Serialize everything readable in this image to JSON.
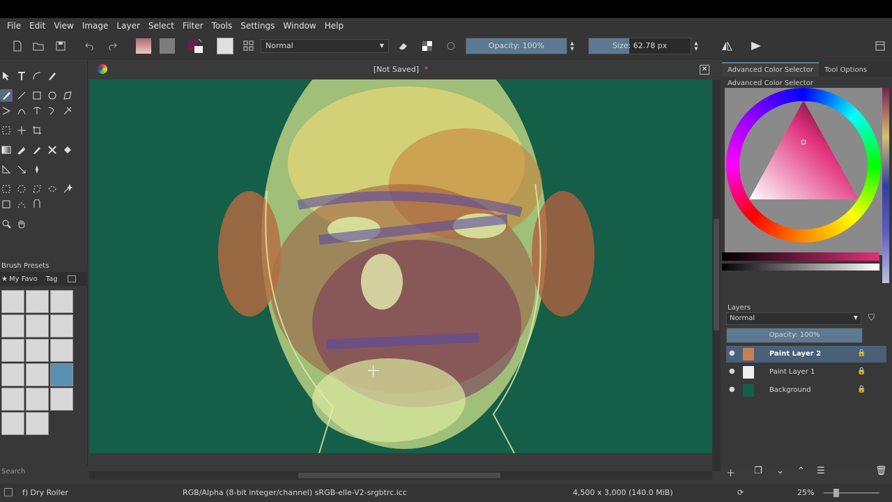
{
  "menu": [
    "File",
    "Edit",
    "View",
    "Image",
    "Layer",
    "Select",
    "Filter",
    "Tools",
    "Settings",
    "Window",
    "Help"
  ],
  "toolbar": {
    "blend_mode": "Normal",
    "opacity_label": "Opacity: 100%",
    "opacity_value": 1.0,
    "size_label": "Size:",
    "size_value": "62.78 px"
  },
  "document": {
    "title": "[Not Saved]",
    "modified_mark": "*"
  },
  "left_dock": {
    "brush_presets_title": "Brush Presets",
    "tag_filter": "My Favo",
    "tag_label": "Tag",
    "search_placeholder": "Search"
  },
  "right_dock": {
    "tabs": [
      "Advanced Color Selector",
      "Tool Options"
    ],
    "color_panel_title": "Advanced Color Selector",
    "layers_title": "Layers",
    "layers_blend": "Normal",
    "layers_opacity": "Opacity:  100%",
    "layers": [
      {
        "name": "Paint Layer 2",
        "selected": true
      },
      {
        "name": "Paint Layer 1",
        "selected": false
      },
      {
        "name": "Background",
        "selected": false
      }
    ]
  },
  "status": {
    "brush_name": "f) Dry Roller",
    "color_profile": "RGB/Alpha (8-bit integer/channel)  sRGB-elle-V2-srgbtrc.icc",
    "image_size": "4,500 x 3,000 (140.0 MiB)",
    "zoom": "25%"
  },
  "colors": {
    "canvas_bg": "#155e48",
    "accent": "#5d7891",
    "fg_color": "#6b2040"
  }
}
